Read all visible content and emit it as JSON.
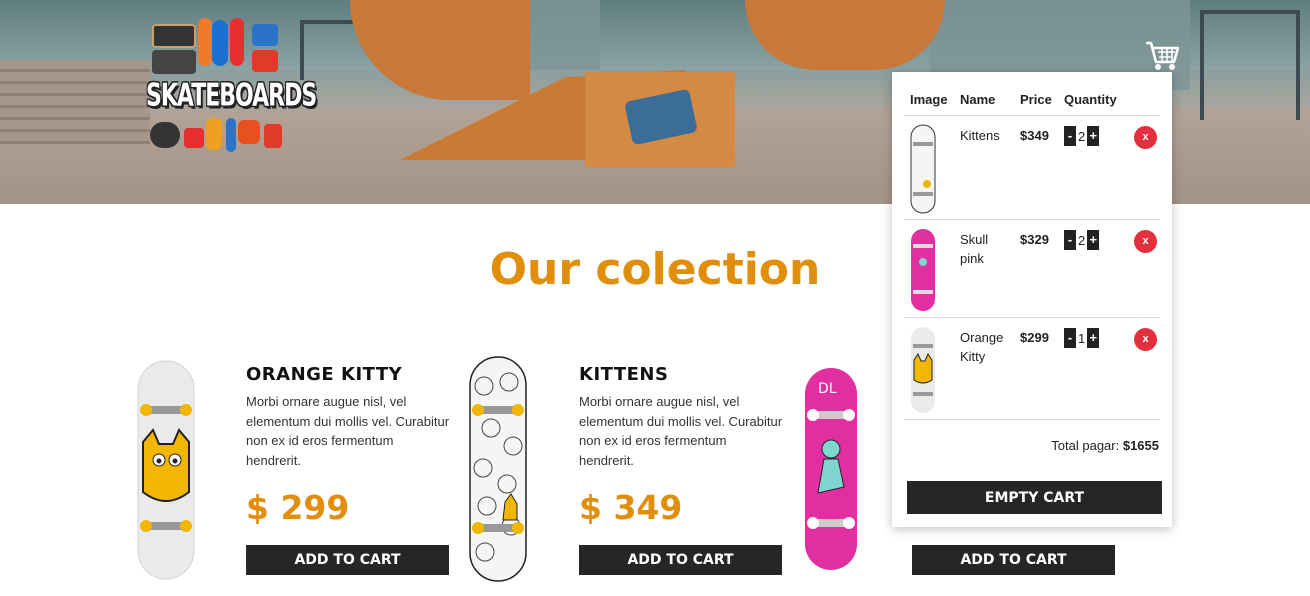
{
  "brand": {
    "logo_text": "SKATEBOARDS"
  },
  "section": {
    "title": "Our colection"
  },
  "products": [
    {
      "name": "ORANGE KITTY",
      "description": "Morbi ornare augue nisl, vel elementum dui mollis vel. Curabitur non ex id eros fermentum hendrerit.",
      "price": "$ 299",
      "button": "ADD TO CART",
      "board_color": "#e8ebea",
      "accent": "#f2b705"
    },
    {
      "name": "KITTENS",
      "description": "Morbi ornare augue nisl, vel elementum dui mollis vel. Curabitur non ex id eros fermentum hendrerit.",
      "price": "$ 349",
      "button": "ADD TO CART",
      "board_color": "#f2f2f2",
      "accent": "#f2b705"
    },
    {
      "name": "",
      "description": "",
      "price": "",
      "button": "ADD TO CART",
      "board_color": "#e12ea0",
      "accent": "#ffffff"
    }
  ],
  "cart": {
    "headers": {
      "image": "Image",
      "name": "Name",
      "price": "Price",
      "quantity": "Quantity"
    },
    "items": [
      {
        "name": "Kittens",
        "price": "$349",
        "quantity": "2",
        "minus": "-",
        "plus": "+",
        "remove": "x",
        "board_color": "#f2f2f2"
      },
      {
        "name": "Skull pink",
        "price": "$329",
        "quantity": "2",
        "minus": "-",
        "plus": "+",
        "remove": "x",
        "board_color": "#e12ea0"
      },
      {
        "name": "Orange Kitty",
        "price": "$299",
        "quantity": "1",
        "minus": "-",
        "plus": "+",
        "remove": "x",
        "board_color": "#e8ebea"
      }
    ],
    "total_label": "Total pagar:",
    "total_value": "$1655",
    "empty_button": "EMPTY CART"
  },
  "colors": {
    "accent": "#e08e0b",
    "dark_button": "#262626",
    "remove": "#e2303f"
  },
  "icons": {
    "cart": "shopping-cart-icon"
  }
}
